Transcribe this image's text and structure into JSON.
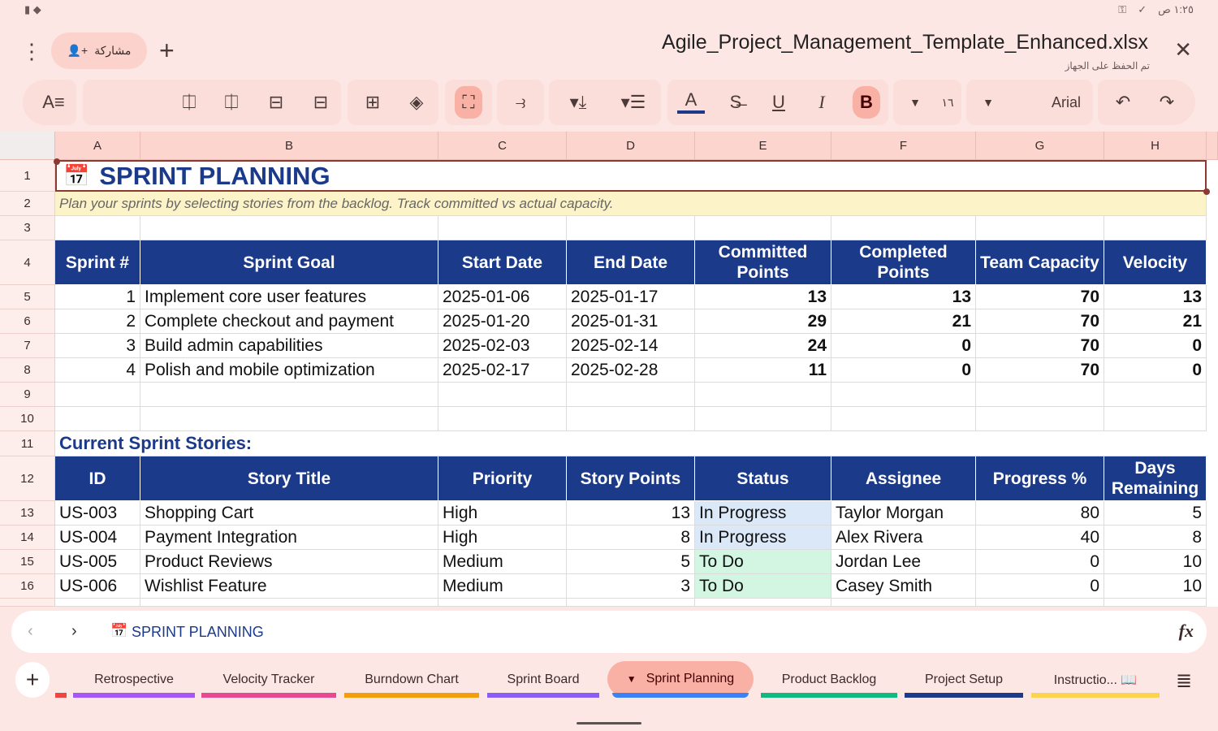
{
  "status_bar": {
    "time": "١:٢٥ ص"
  },
  "header": {
    "share_label": "مشاركة",
    "file_title": "Agile_Project_Management_Template_Enhanced.xlsx",
    "save_status": "تم الحفظ على الجهاز"
  },
  "toolbar": {
    "font_size": "١٦",
    "font_name": "Arial",
    "bold": "B",
    "text_color": "#1c3a8a"
  },
  "columns": [
    "A",
    "B",
    "C",
    "D",
    "E",
    "F",
    "G",
    "H"
  ],
  "rows": [
    "1",
    "2",
    "3",
    "4",
    "5",
    "6",
    "7",
    "8",
    "9",
    "10",
    "11",
    "12",
    "13",
    "14",
    "15",
    "16"
  ],
  "sheet": {
    "title": "SPRINT PLANNING",
    "subtitle": "Plan your sprints by selecting stories from the backlog. Track committed vs actual capacity.",
    "sprint_headers": [
      "Sprint #",
      "Sprint Goal",
      "Start Date",
      "End Date",
      "Committed Points",
      "Completed Points",
      "Team Capacity",
      "Velocity"
    ],
    "sprints": [
      [
        "1",
        "Implement core user features",
        "2025-01-06",
        "2025-01-17",
        "13",
        "13",
        "70",
        "13"
      ],
      [
        "2",
        "Complete checkout and payment",
        "2025-01-20",
        "2025-01-31",
        "29",
        "21",
        "70",
        "21"
      ],
      [
        "3",
        "Build admin capabilities",
        "2025-02-03",
        "2025-02-14",
        "24",
        "0",
        "70",
        "0"
      ],
      [
        "4",
        "Polish and mobile optimization",
        "2025-02-17",
        "2025-02-28",
        "11",
        "0",
        "70",
        "0"
      ]
    ],
    "stories_title": "Current Sprint Stories:",
    "story_headers": [
      "ID",
      "Story Title",
      "Priority",
      "Story Points",
      "Status",
      "Assignee",
      "Progress %",
      "Days Remaining"
    ],
    "stories": [
      [
        "US-003",
        "Shopping Cart",
        "High",
        "13",
        "In Progress",
        "Taylor Morgan",
        "80",
        "5"
      ],
      [
        "US-004",
        "Payment Integration",
        "High",
        "8",
        "In Progress",
        "Alex Rivera",
        "40",
        "8"
      ],
      [
        "US-005",
        "Product Reviews",
        "Medium",
        "5",
        "To Do",
        "Jordan Lee",
        "0",
        "10"
      ],
      [
        "US-006",
        "Wishlist Feature",
        "Medium",
        "3",
        "To Do",
        "Casey Smith",
        "0",
        "10"
      ]
    ],
    "status_colors": {
      "In Progress": "#dbe8f8",
      "To Do": "#d2f6e2"
    }
  },
  "formula_bar": {
    "cell_content": "SPRINT PLANNING"
  },
  "sheet_tabs": [
    {
      "label": "Retrospective",
      "color": "#a855f7"
    },
    {
      "label": "Velocity Tracker",
      "color": "#e64891"
    },
    {
      "label": "Burndown Chart",
      "color": "#f59e0b"
    },
    {
      "label": "Sprint Board",
      "color": "#8b5cf6"
    },
    {
      "label": "Sprint Planning",
      "color": "#3b82f6",
      "active": true
    },
    {
      "label": "Product Backlog",
      "color": "#10b981"
    },
    {
      "label": "Project Setup",
      "color": "#1e3a8a"
    },
    {
      "label": "Instructio... 📖",
      "color": "#fcd34d"
    }
  ]
}
